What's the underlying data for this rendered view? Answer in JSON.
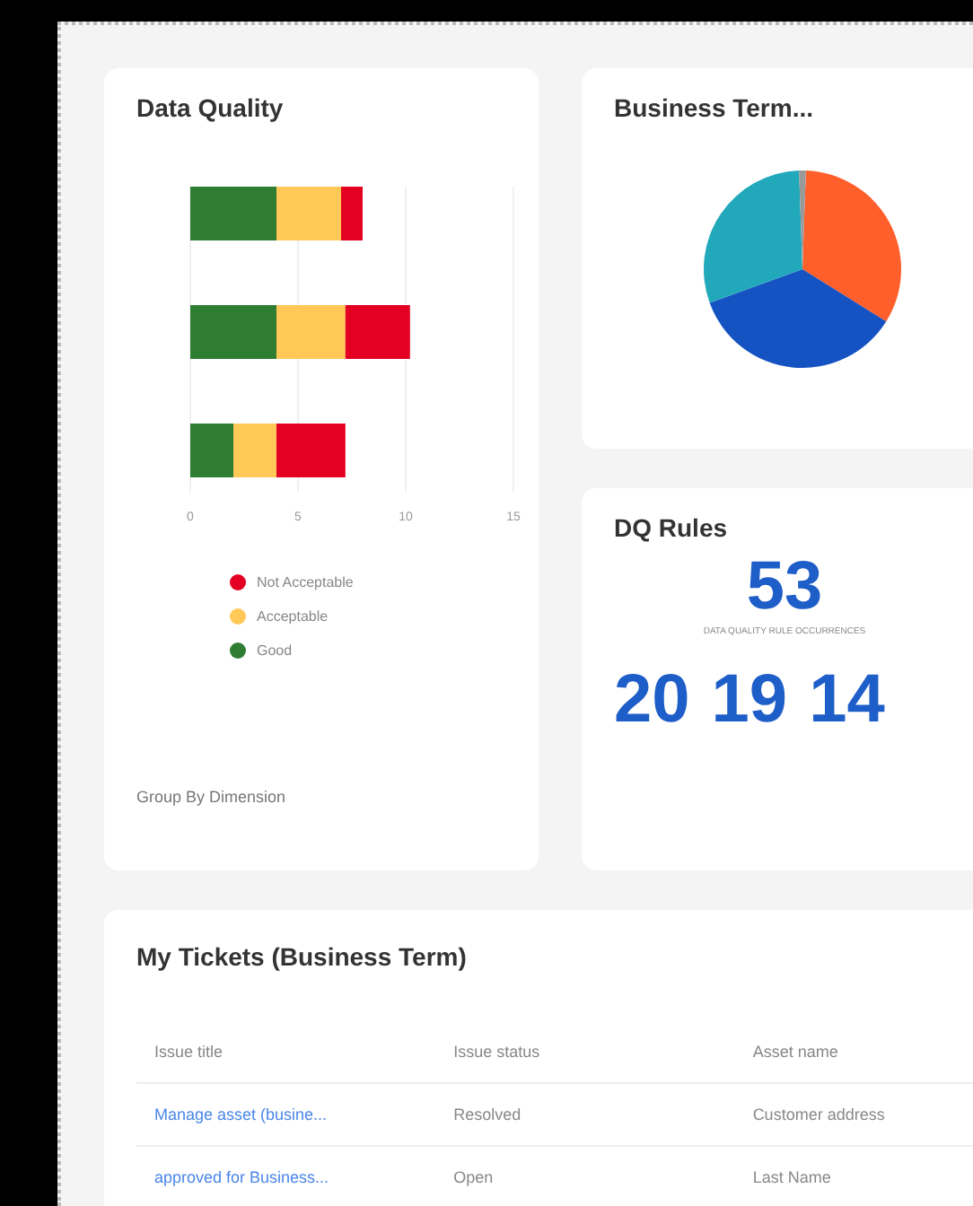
{
  "data_quality": {
    "title": "Data Quality",
    "chart_data": {
      "type": "bar",
      "orientation": "horizontal",
      "stacked": true,
      "xlim": [
        0,
        15
      ],
      "xticks": [
        0,
        5,
        10,
        15
      ],
      "series": [
        {
          "name": "Good",
          "color": "#2e7d32",
          "values": [
            4,
            4,
            2
          ]
        },
        {
          "name": "Acceptable",
          "color": "#ffc857",
          "values": [
            3,
            3.2,
            2
          ]
        },
        {
          "name": "Not Acceptable",
          "color": "#e30022",
          "values": [
            1,
            3,
            3.2
          ]
        }
      ]
    },
    "footer": "Group By Dimension"
  },
  "business_term": {
    "title": "Business Term..."
  },
  "dq_rules": {
    "title": "DQ Rules",
    "total": "53",
    "caption": "DATA QUALITY RULE OCCURRENCES",
    "counts": [
      "20",
      "19",
      "14"
    ]
  },
  "tickets": {
    "title": "My Tickets (Business Term)",
    "columns": [
      "Issue title",
      "Issue status",
      "Asset name"
    ],
    "rows": [
      [
        "Manage asset (busine...",
        "Resolved",
        "Customer address"
      ],
      [
        "approved for Business...",
        "Open",
        "Last Name"
      ]
    ]
  }
}
